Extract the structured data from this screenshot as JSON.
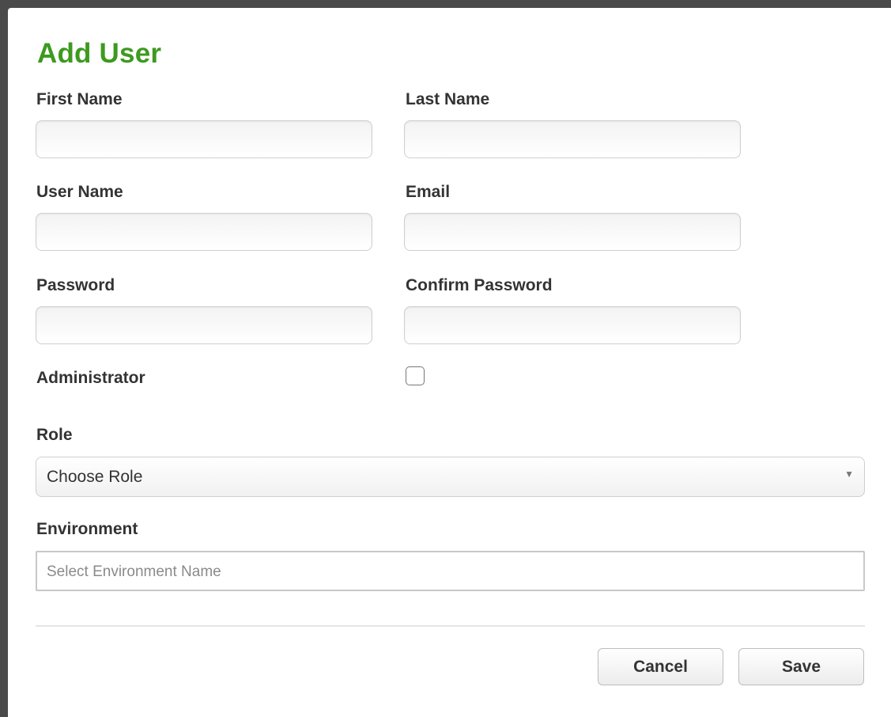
{
  "dialog": {
    "title": "Add User",
    "title_color": "#3d9a1f"
  },
  "fields": {
    "first_name": {
      "label": "First Name",
      "value": ""
    },
    "last_name": {
      "label": "Last Name",
      "value": ""
    },
    "user_name": {
      "label": "User Name",
      "value": ""
    },
    "email": {
      "label": "Email",
      "value": ""
    },
    "password": {
      "label": "Password",
      "value": ""
    },
    "confirm_password": {
      "label": "Confirm Password",
      "value": ""
    },
    "administrator": {
      "label": "Administrator",
      "checked": false
    },
    "role": {
      "label": "Role",
      "selected": "Choose Role",
      "arrow_icon": "triangle-down-icon"
    },
    "environment": {
      "label": "Environment",
      "placeholder": "Select Environment Name"
    }
  },
  "actions": {
    "cancel_label": "Cancel",
    "save_label": "Save"
  }
}
